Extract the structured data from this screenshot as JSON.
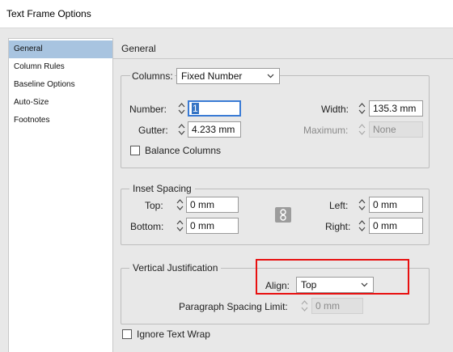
{
  "window": {
    "title": "Text Frame Options"
  },
  "sidebar": {
    "items": [
      {
        "label": "General",
        "selected": true
      },
      {
        "label": "Column Rules",
        "selected": false
      },
      {
        "label": "Baseline Options",
        "selected": false
      },
      {
        "label": "Auto-Size",
        "selected": false
      },
      {
        "label": "Footnotes",
        "selected": false
      }
    ]
  },
  "main": {
    "section_title": "General",
    "columns": {
      "type_label": "Columns:",
      "type_value": "Fixed Number",
      "number_label": "Number:",
      "number_value": "1",
      "gutter_label": "Gutter:",
      "gutter_value": "4.233 mm",
      "width_label": "Width:",
      "width_value": "135.3 mm",
      "maximum_label": "Maximum:",
      "maximum_value": "None",
      "balance_label": "Balance Columns",
      "balance_checked": false
    },
    "inset_spacing": {
      "title": "Inset Spacing",
      "top_label": "Top:",
      "top_value": "0 mm",
      "bottom_label": "Bottom:",
      "bottom_value": "0 mm",
      "left_label": "Left:",
      "left_value": "0 mm",
      "right_label": "Right:",
      "right_value": "0 mm"
    },
    "vertical_justification": {
      "title": "Vertical Justification",
      "align_label": "Align:",
      "align_value": "Top",
      "paragraph_spacing_label": "Paragraph Spacing Limit:",
      "paragraph_spacing_value": "0 mm"
    },
    "ignore_text_wrap_label": "Ignore Text Wrap",
    "ignore_text_wrap_checked": false
  },
  "colors": {
    "selection": "#a8c4e0",
    "highlight_box": "#e81010",
    "focus": "#3a7bd5"
  }
}
